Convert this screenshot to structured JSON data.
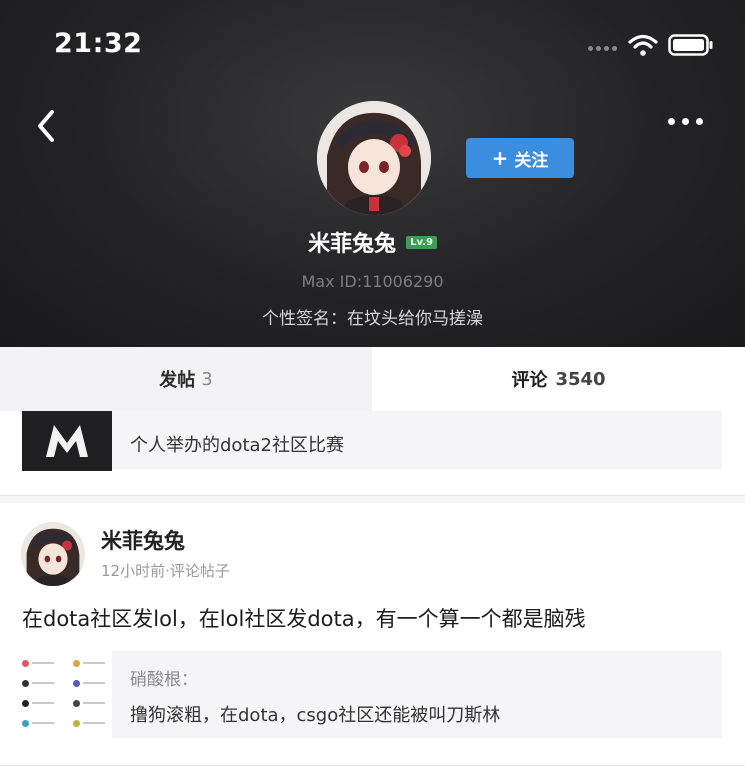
{
  "status_bar": {
    "time": "21:32"
  },
  "profile": {
    "username": "米菲兔兔",
    "level": "Lv.9",
    "max_id": "Max ID:11006290",
    "signature": "个性签名：在坟头给你马搓澡",
    "follow_label": "关注"
  },
  "tabs": [
    {
      "label": "发帖",
      "count": "3"
    },
    {
      "label": "评论",
      "count": "3540"
    }
  ],
  "feed": {
    "card1": {
      "quote_text": "个人举办的dota2社区比赛"
    },
    "card2": {
      "author": "米菲兔兔",
      "meta": "12小时前·评论帖子",
      "body": "在dota社区发lol，在lol社区发dota，有一个算一个都是脑残",
      "quote_author": "硝酸根：",
      "quote_text": "撸狗滚粗，在dota，csgo社区还能被叫刀斯林"
    }
  },
  "icons": {
    "back": "chevron-left-icon",
    "more": "more-horizontal-icon",
    "wifi": "wifi-icon",
    "battery": "battery-icon"
  },
  "colors": {
    "follow_button": "#3b8de0",
    "level_badge": "#3f9b55"
  }
}
